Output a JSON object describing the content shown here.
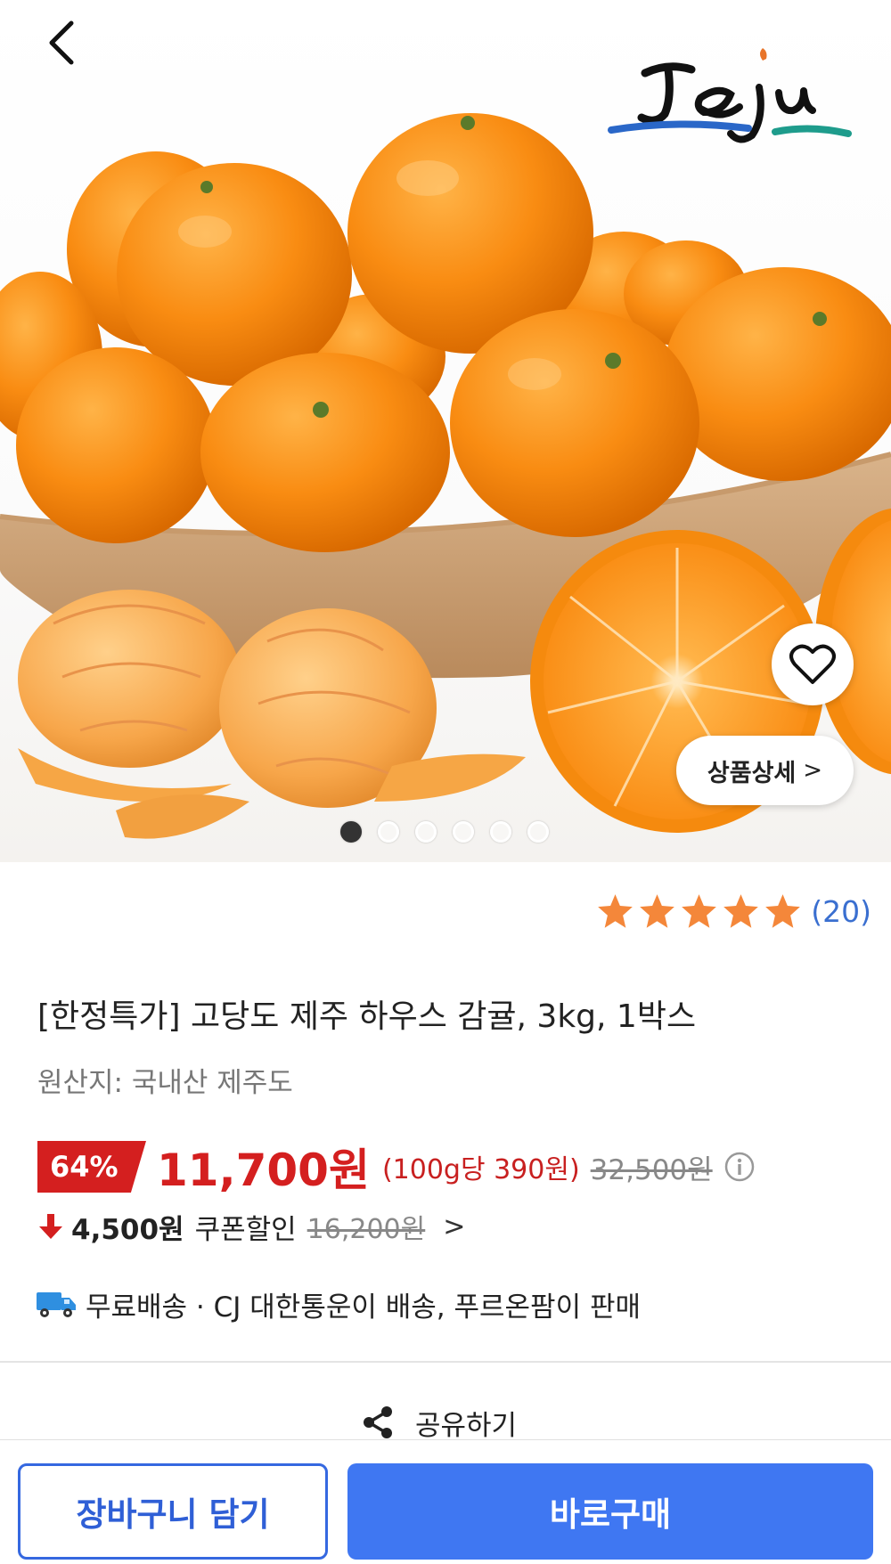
{
  "hero": {
    "logo_text": "Jeju",
    "detail_button_label": "상품상세",
    "image_count": 6,
    "active_image_index": 0
  },
  "rating": {
    "stars": 5,
    "review_count": "(20)"
  },
  "product": {
    "title": "[한정특가] 고당도 제주 하우스 감귤, 3kg, 1박스",
    "origin": "원산지: 국내산 제주도"
  },
  "price": {
    "discount": "64%",
    "sale_price": "11,700원",
    "unit_price": "(100g당 390원)",
    "original_price": "32,500원"
  },
  "coupon": {
    "amount": "4,500원",
    "label": "쿠폰할인",
    "price_before": "16,200원"
  },
  "shipping": {
    "text": "무료배송 · CJ 대한통운이 배송, 푸르온팜이 판매"
  },
  "share": {
    "label": "공유하기"
  },
  "bottom_bar": {
    "cart_label": "장바구니 담기",
    "buy_label": "바로구매"
  },
  "colors": {
    "accent_blue": "#3f77f2",
    "sale_red": "#d41f1f",
    "star_orange": "#f4873a",
    "review_blue": "#3a6fd0"
  }
}
